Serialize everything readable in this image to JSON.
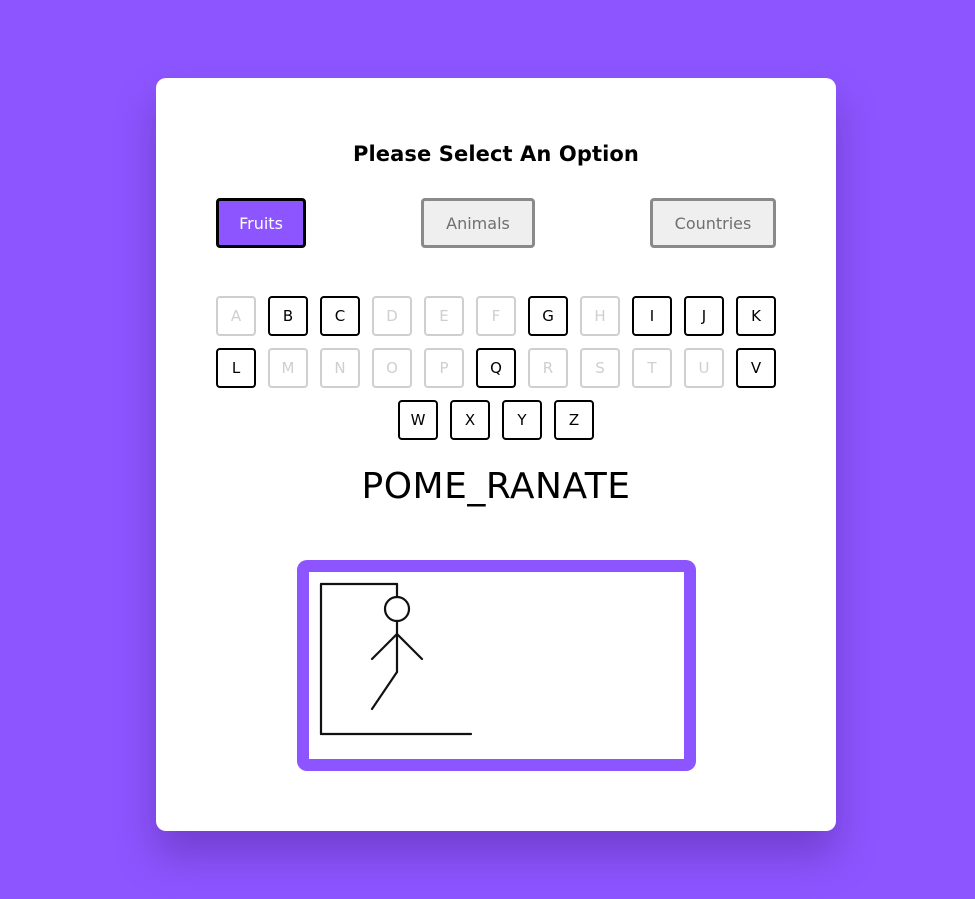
{
  "title": "Please Select An Option",
  "options": [
    {
      "label": "Fruits",
      "active": true
    },
    {
      "label": "Animals",
      "active": false
    },
    {
      "label": "Countries",
      "active": false
    }
  ],
  "keyboard": {
    "rows": [
      [
        {
          "letter": "A",
          "enabled": false
        },
        {
          "letter": "B",
          "enabled": true
        },
        {
          "letter": "C",
          "enabled": true
        },
        {
          "letter": "D",
          "enabled": false
        },
        {
          "letter": "E",
          "enabled": false
        },
        {
          "letter": "F",
          "enabled": false
        },
        {
          "letter": "G",
          "enabled": true
        },
        {
          "letter": "H",
          "enabled": false
        },
        {
          "letter": "I",
          "enabled": true
        },
        {
          "letter": "J",
          "enabled": true
        },
        {
          "letter": "K",
          "enabled": true
        }
      ],
      [
        {
          "letter": "L",
          "enabled": true
        },
        {
          "letter": "M",
          "enabled": false
        },
        {
          "letter": "N",
          "enabled": false
        },
        {
          "letter": "O",
          "enabled": false
        },
        {
          "letter": "P",
          "enabled": false
        },
        {
          "letter": "Q",
          "enabled": true
        },
        {
          "letter": "R",
          "enabled": false
        },
        {
          "letter": "S",
          "enabled": false
        },
        {
          "letter": "T",
          "enabled": false
        },
        {
          "letter": "U",
          "enabled": false
        },
        {
          "letter": "V",
          "enabled": true
        }
      ],
      [
        {
          "letter": "W",
          "enabled": true
        },
        {
          "letter": "X",
          "enabled": true
        },
        {
          "letter": "Y",
          "enabled": true
        },
        {
          "letter": "Z",
          "enabled": true
        }
      ]
    ]
  },
  "word_display": "POME_RANATE",
  "hangman": {
    "parts_drawn": [
      "base",
      "pole",
      "beam",
      "rope",
      "head",
      "body",
      "left-arm",
      "right-arm",
      "left-leg"
    ]
  },
  "colors": {
    "accent": "#8c55ff",
    "card": "#ffffff",
    "disabled_key": "#cfcfcf"
  }
}
